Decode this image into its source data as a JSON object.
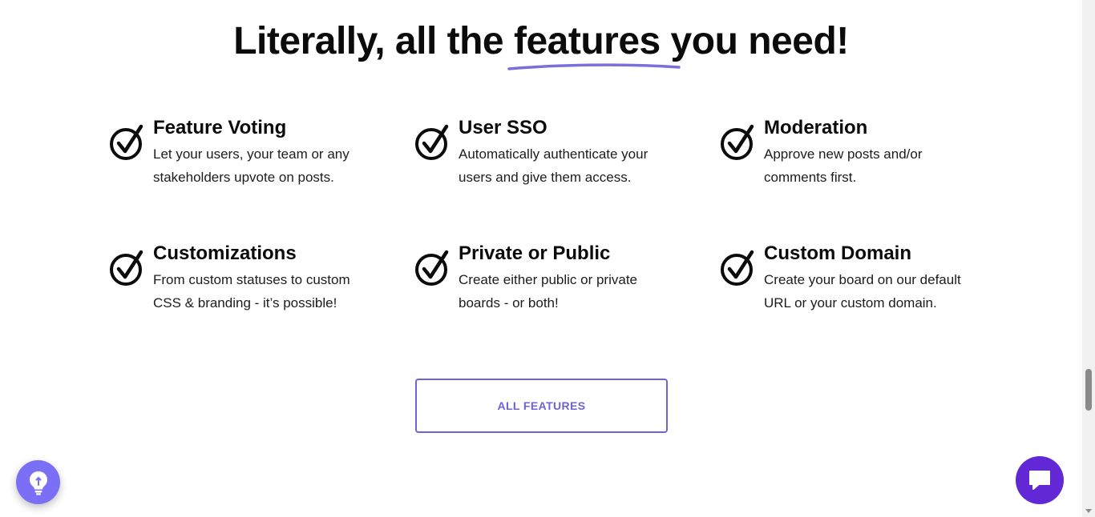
{
  "headline": {
    "before": "Literally, all the ",
    "highlight": "features",
    "after": " you need!"
  },
  "colors": {
    "accent": "#6c63d6",
    "underline": "#7b6fdc",
    "idea_button": "#7a6ff5",
    "chat_button": "#6328d6"
  },
  "features": [
    {
      "icon": "check-circle-icon",
      "title": "Feature Voting",
      "description": "Let your users, your team or any stakeholders upvote on posts."
    },
    {
      "icon": "check-circle-icon",
      "title": "User SSO",
      "description": "Automatically authenticate your users and give them access."
    },
    {
      "icon": "check-circle-icon",
      "title": "Moderation",
      "description": "Approve new posts and/or comments first."
    },
    {
      "icon": "check-circle-icon",
      "title": "Customizations",
      "description": "From custom statuses to custom CSS & branding - it’s possible!"
    },
    {
      "icon": "check-circle-icon",
      "title": "Private or Public",
      "description": "Create either public or private boards - or both!"
    },
    {
      "icon": "check-circle-icon",
      "title": "Custom Domain",
      "description": "Create your board on our default URL or your custom domain."
    }
  ],
  "cta": {
    "label": "ALL FEATURES"
  },
  "floating": {
    "idea_icon": "lightbulb-icon",
    "chat_icon": "chat-bubble-icon"
  }
}
